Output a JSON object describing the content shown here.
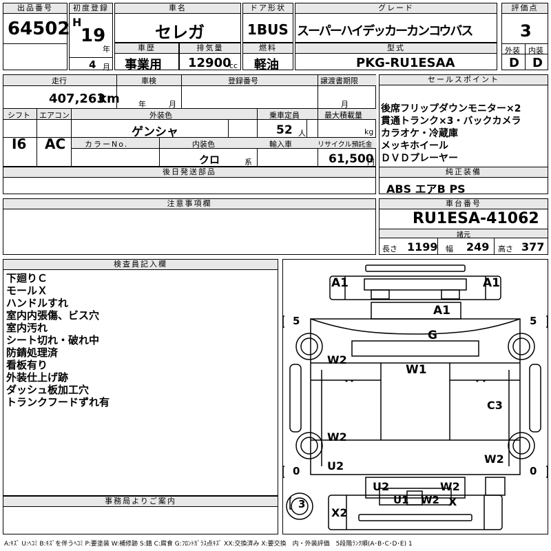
{
  "labels": {
    "lot_no": "出品番号",
    "first_reg": "初度登録",
    "car_name": "車名",
    "door": "ドア形状",
    "grade": "グレード",
    "score": "評価点",
    "era_mark": "H",
    "year_unit": "年",
    "month_unit": "月",
    "history": "車歴",
    "displacement": "排気量",
    "fuel": "燃料",
    "model": "型式",
    "exterior": "外装",
    "interior": "内装",
    "mileage": "走行",
    "inspection": "車検",
    "reg_no": "登録番号",
    "transfer": "譲渡書期限",
    "sales_points": "セールスポイント",
    "shift": "シフト",
    "aircon": "エアコン",
    "ext_color": "外装色",
    "capacity": "乗車定員",
    "max_load": "最大積載量",
    "color_no": "カラーNo.",
    "int_color": "内装色",
    "import": "輸入車",
    "recycle": "リサイクル預託金",
    "later_parts": "後日発送部品",
    "genuine": "純正装備",
    "caution": "注意事項欄",
    "chassis_no": "車台番号",
    "specs": "諸元",
    "inspector_notes": "検査員記入欄",
    "office_notes": "事務局よりご案内",
    "cc_unit": "cc",
    "km_unit": "km",
    "person_unit": "人",
    "kg_unit": "kg",
    "yen_unit": "円",
    "series_unit": "系",
    "year": "年",
    "month": "月",
    "length": "長さ",
    "width": "幅",
    "height": "高さ"
  },
  "values": {
    "lot_no": "64502",
    "year": "19",
    "month": "4",
    "car_name": "セレガ",
    "door": "1BUS",
    "grade": "スーパーハイデッカーカンコウバス",
    "score": "3",
    "history": "事業用",
    "displacement": "12900",
    "fuel": "軽油",
    "model": "PKG-RU1ESAA",
    "exterior": "D",
    "interior": "D",
    "mileage": "407,263",
    "shift": "I6",
    "aircon": "AC",
    "ext_color": "ゲンシャ",
    "capacity": "52",
    "int_color": "クロ",
    "recycle": "61,500",
    "genuine": "ABS エアB PS",
    "chassis_no": "RU1ESA-41062",
    "length": "1199",
    "width": "249",
    "height": "377"
  },
  "sales_points": [
    "後席フリップダウンモニター×2",
    "貫通トランク×3・バックカメラ",
    "カラオケ・冷蔵庫",
    "メッキホイール",
    "ＤＶＤプレーヤー"
  ],
  "inspector_notes": [
    "下廻りＣ",
    "モールＸ",
    "ハンドルすれ",
    "室内内張傷、ビス穴",
    "室内汚れ",
    "シート切れ・破れ中",
    "防錆処理済",
    "看板有り",
    "外装仕上げ跡",
    "ダッシュ板加工穴",
    "トランクフードずれ有"
  ],
  "diagram": {
    "marks": [
      "A1",
      "A1",
      "A1",
      "G",
      "W1",
      "W2",
      "W2",
      "W2",
      "C3",
      "U2",
      "U2",
      "U1",
      "W2",
      "W2",
      "X",
      "X2"
    ],
    "tire_labels": [
      "5",
      "5",
      "0",
      "0",
      "3"
    ]
  },
  "legend": "A:ｷｽﾞ U:ﾍｺﾐ B:ｷｽﾞを伴うﾍｺﾐ P:要塗装 W:補修跡 S:錆 C:腐食 G:ﾌﾛﾝﾄｶﾞﾗｽ点ｷｽﾞ XX:交換済み X:要交換　内・外装評価　5段階ﾗﾝｸ順(A･B･C･D･E) 1"
}
